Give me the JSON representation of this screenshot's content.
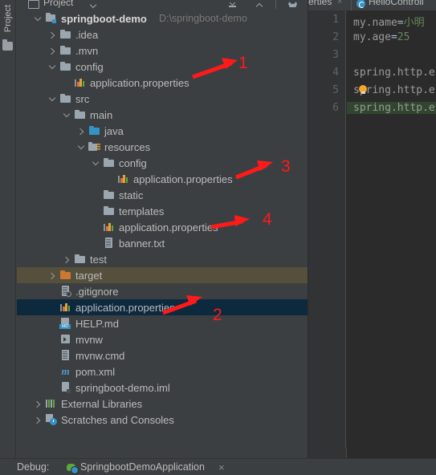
{
  "window": {
    "tool_stripe_label": "Project"
  },
  "project_panel": {
    "title": "Project",
    "icons": [
      "window-icon",
      "chevron-down-icon",
      "collapse-all-icon",
      "scroll-up-icon",
      "settings-gear-icon"
    ]
  },
  "tree": {
    "rows": [
      {
        "label": "springboot-demo",
        "suffix": "D:\\springboot-demo",
        "icon": "module-folder-icon",
        "arrow": "expanded",
        "depth": 0,
        "state": "bold"
      },
      {
        "label": ".idea",
        "icon": "folder-icon",
        "arrow": "collapsed",
        "depth": 1,
        "state": "normal"
      },
      {
        "label": ".mvn",
        "icon": "folder-icon",
        "arrow": "collapsed",
        "depth": 1,
        "state": "normal"
      },
      {
        "label": "config",
        "icon": "folder-icon",
        "arrow": "expanded",
        "depth": 1,
        "state": "normal"
      },
      {
        "label": "application.properties",
        "icon": "properties-file-icon",
        "arrow": "none",
        "depth": 2,
        "state": "normal"
      },
      {
        "label": "src",
        "icon": "folder-icon",
        "arrow": "expanded",
        "depth": 1,
        "state": "normal"
      },
      {
        "label": "main",
        "icon": "folder-icon",
        "arrow": "expanded",
        "depth": 2,
        "state": "normal"
      },
      {
        "label": "java",
        "icon": "source-folder-icon",
        "arrow": "collapsed",
        "depth": 3,
        "state": "normal"
      },
      {
        "label": "resources",
        "icon": "resources-folder-icon",
        "arrow": "expanded",
        "depth": 3,
        "state": "normal"
      },
      {
        "label": "config",
        "icon": "folder-icon",
        "arrow": "expanded",
        "depth": 4,
        "state": "normal"
      },
      {
        "label": "application.properties",
        "icon": "properties-file-icon",
        "arrow": "none",
        "depth": 5,
        "state": "normal"
      },
      {
        "label": "static",
        "icon": "folder-icon",
        "arrow": "none",
        "depth": 4,
        "state": "normal"
      },
      {
        "label": "templates",
        "icon": "folder-icon",
        "arrow": "none",
        "depth": 4,
        "state": "normal"
      },
      {
        "label": "application.properties",
        "icon": "properties-file-icon",
        "arrow": "none",
        "depth": 4,
        "state": "normal"
      },
      {
        "label": "banner.txt",
        "icon": "text-file-icon",
        "arrow": "none",
        "depth": 4,
        "state": "normal"
      },
      {
        "label": "test",
        "icon": "folder-icon",
        "arrow": "collapsed",
        "depth": 2,
        "state": "normal"
      },
      {
        "label": "target",
        "icon": "excluded-folder-icon",
        "arrow": "collapsed",
        "depth": 1,
        "state": "excluded"
      },
      {
        "label": ".gitignore",
        "icon": "gitignore-file-icon",
        "arrow": "none",
        "depth": 1,
        "state": "normal"
      },
      {
        "label": "application.properties",
        "icon": "properties-file-icon",
        "arrow": "none",
        "depth": 1,
        "state": "selected"
      },
      {
        "label": "HELP.md",
        "icon": "markdown-file-icon",
        "arrow": "none",
        "depth": 1,
        "state": "normal"
      },
      {
        "label": "mvnw",
        "icon": "shell-script-icon",
        "arrow": "none",
        "depth": 1,
        "state": "normal"
      },
      {
        "label": "mvnw.cmd",
        "icon": "text-file-icon",
        "arrow": "none",
        "depth": 1,
        "state": "normal"
      },
      {
        "label": "pom.xml",
        "icon": "maven-file-icon",
        "arrow": "none",
        "depth": 1,
        "state": "normal"
      },
      {
        "label": "springboot-demo.iml",
        "icon": "iml-file-icon",
        "arrow": "none",
        "depth": 1,
        "state": "normal"
      },
      {
        "label": "External Libraries",
        "icon": "external-libraries-icon",
        "arrow": "collapsed",
        "depth": 0,
        "state": "normal"
      },
      {
        "label": "Scratches and Consoles",
        "icon": "scratches-icon",
        "arrow": "collapsed",
        "depth": 0,
        "state": "normal"
      }
    ]
  },
  "annotations": [
    {
      "number": "1",
      "target": "config/application.properties"
    },
    {
      "number": "2",
      "target": "root application.properties"
    },
    {
      "number": "3",
      "target": "resources/config/application.properties"
    },
    {
      "number": "4",
      "target": "resources/application.properties"
    }
  ],
  "editor": {
    "tabs": [
      {
        "label": "erties",
        "close": "×",
        "active": false
      },
      {
        "label": "HelloControll",
        "icon": "java-class-icon",
        "active": true
      }
    ],
    "line_numbers": [
      "1",
      "2",
      "3",
      "4",
      "5",
      "6"
    ],
    "lines": [
      {
        "n": "1",
        "key": "my.name",
        "eq": "=",
        "value": "小明",
        "highlight": false,
        "bulb": false
      },
      {
        "n": "2",
        "key": "my.age",
        "eq": "=",
        "value": "25",
        "highlight": false,
        "bulb": false
      },
      {
        "n": "3",
        "key": "",
        "eq": "",
        "value": "",
        "highlight": false,
        "bulb": false
      },
      {
        "n": "4",
        "key": "spring.http.e",
        "eq": "",
        "value": "",
        "highlight": false,
        "bulb": false
      },
      {
        "n": "5",
        "key": "spring.http.e",
        "eq": "",
        "value": "",
        "highlight": false,
        "bulb": true
      },
      {
        "n": "6",
        "key": "spring.http.e",
        "eq": "",
        "value": "",
        "highlight": true,
        "bulb": false
      }
    ]
  },
  "bottom_bar": {
    "debug_label": "Debug:",
    "run_config": "SpringbootDemoApplication",
    "close": "×"
  },
  "colors": {
    "background": "#3c3f41",
    "editor_background": "#2b2b2b",
    "selection": "#0d293e",
    "excluded": "#55503c",
    "annotation_red": "#ff1a1a",
    "string_green": "#6a8759",
    "highlight_green": "#32462f"
  }
}
